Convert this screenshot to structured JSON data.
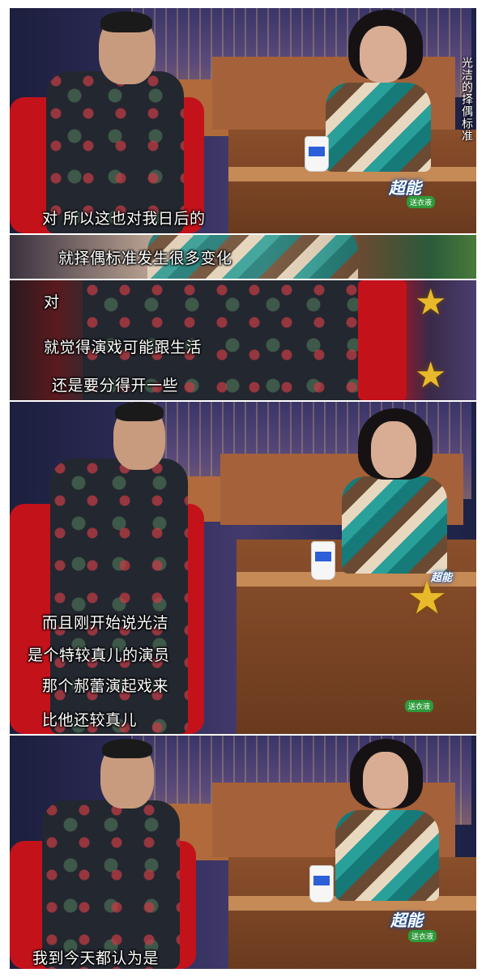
{
  "panels": [
    {
      "subtitles": [
        "对 所以这也对我日后的"
      ],
      "side_caption": "光洁的择偶标准",
      "logo": "超能",
      "logo_sub": "送衣液"
    },
    {
      "subtitles": [
        "就择偶标准发生很多变化"
      ]
    },
    {
      "subtitles": [
        "对",
        "就觉得演戏可能跟生活",
        "还是要分得开一些"
      ]
    },
    {
      "subtitles": [
        "而且刚开始说光洁",
        "是个特较真儿的演员",
        "那个郝蕾演起戏来",
        "比他还较真儿"
      ],
      "logo": "超能",
      "logo_sub": "送衣液"
    },
    {
      "subtitles": [
        "我到今天都认为是"
      ],
      "logo": "超能",
      "logo_sub": "送衣液"
    }
  ]
}
